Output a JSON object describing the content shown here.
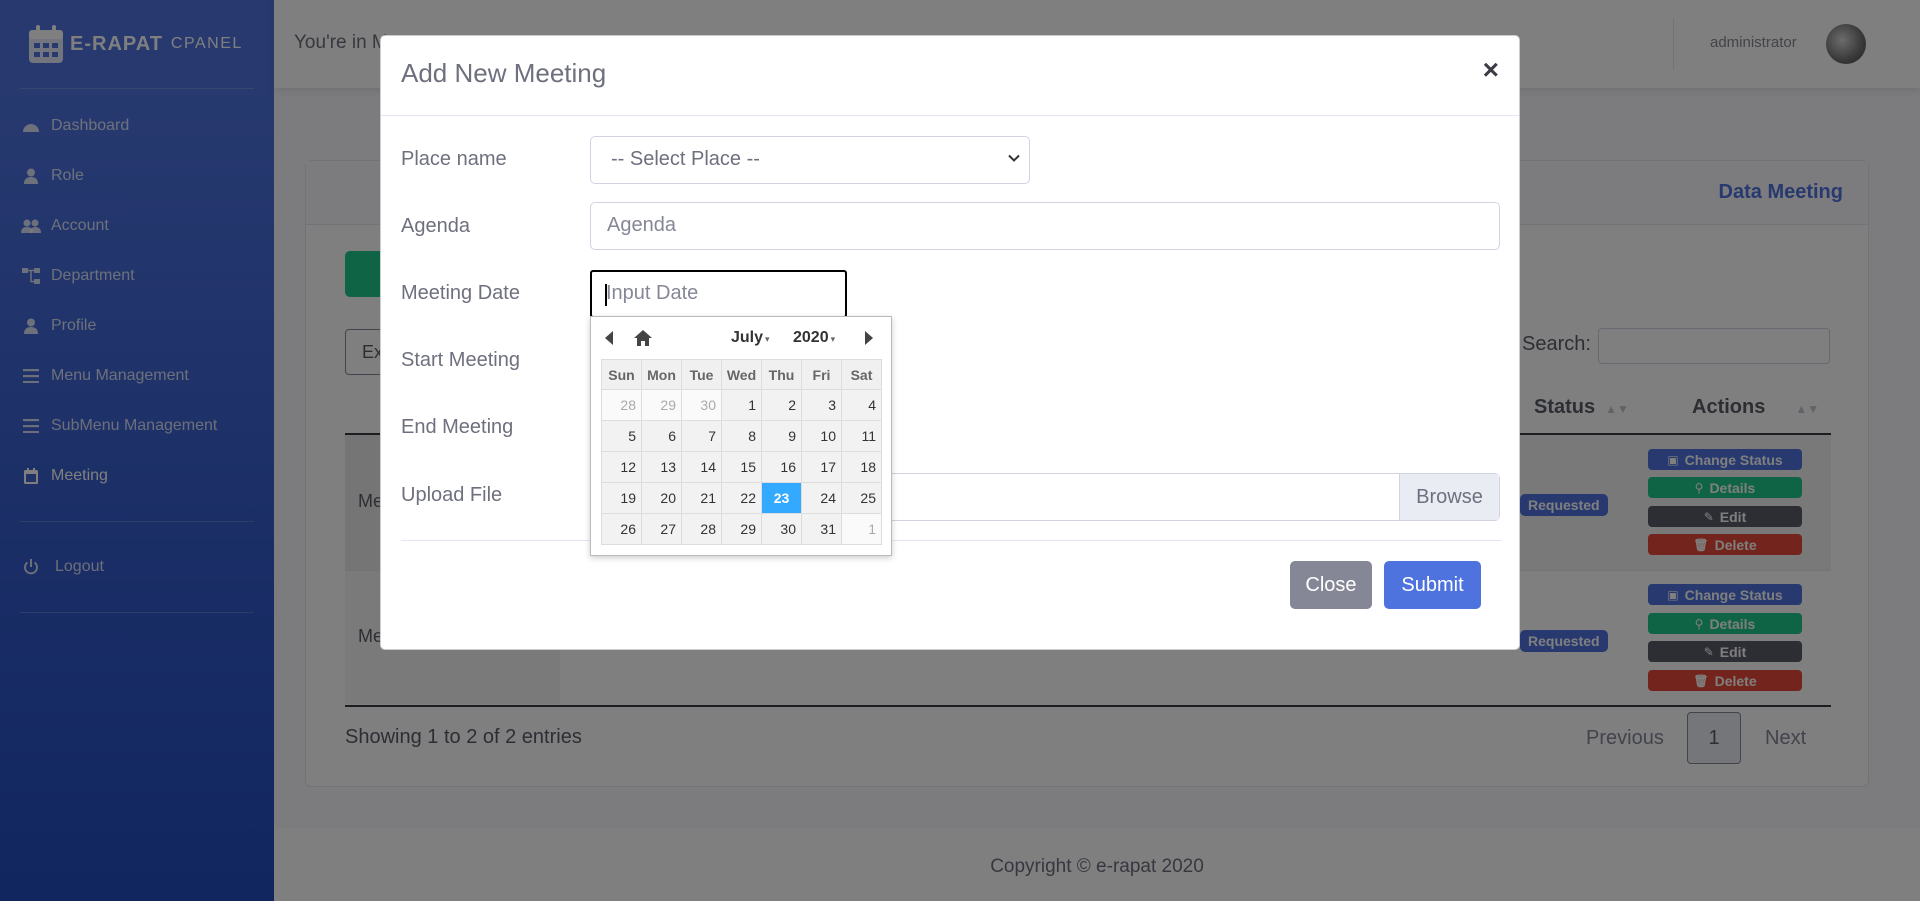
{
  "sidebar": {
    "brand_main": "E-RAPAT",
    "brand_sub": "CPANEL",
    "items": [
      {
        "label": "Dashboard",
        "icon": "dashboard-icon"
      },
      {
        "label": "Role",
        "icon": "user-icon"
      },
      {
        "label": "Account",
        "icon": "users-icon"
      },
      {
        "label": "Department",
        "icon": "sitemap-icon"
      },
      {
        "label": "Profile",
        "icon": "user-icon"
      },
      {
        "label": "Menu Management",
        "icon": "list-icon"
      },
      {
        "label": "SubMenu Management",
        "icon": "list-icon"
      },
      {
        "label": "Meeting",
        "icon": "calendar-icon"
      }
    ],
    "logout": "Logout"
  },
  "topbar": {
    "greeting": "You're in M",
    "user": "administrator"
  },
  "card": {
    "title": "Data Meeting",
    "export_label": "Ex",
    "search_label": "Search:",
    "columns": {
      "status": "Status",
      "actions": "Actions"
    },
    "rows": [
      {
        "first": "Me",
        "status": "Requested"
      },
      {
        "first": "Me",
        "status": "Requested"
      }
    ],
    "actions": {
      "change_status": "Change Status",
      "details": "Details",
      "edit": "Edit",
      "delete": "Delete"
    },
    "info": "Showing 1 to 2 of 2 entries",
    "pagination": {
      "previous": "Previous",
      "current": "1",
      "next": "Next"
    }
  },
  "footer": {
    "copyright": "Copyright © e-rapat 2020"
  },
  "modal": {
    "title": "Add New Meeting",
    "close_x": "×",
    "labels": {
      "place": "Place name",
      "agenda": "Agenda",
      "date": "Meeting Date",
      "start": "Start Meeting",
      "end": "End Meeting",
      "upload": "Upload File"
    },
    "place_selected": "-- Select Place --",
    "agenda_placeholder": "Agenda",
    "date_placeholder": "Input Date",
    "browse": "Browse",
    "close_button": "Close",
    "submit_button": "Submit"
  },
  "datepicker": {
    "month": "July",
    "year": "2020",
    "weekdays": [
      "Sun",
      "Mon",
      "Tue",
      "Wed",
      "Thu",
      "Fri",
      "Sat"
    ],
    "weeks": [
      [
        "28",
        "29",
        "30",
        "1",
        "2",
        "3",
        "4"
      ],
      [
        "5",
        "6",
        "7",
        "8",
        "9",
        "10",
        "11"
      ],
      [
        "12",
        "13",
        "14",
        "15",
        "16",
        "17",
        "18"
      ],
      [
        "19",
        "20",
        "21",
        "22",
        "23",
        "24",
        "25"
      ],
      [
        "26",
        "27",
        "28",
        "29",
        "30",
        "31",
        "1"
      ]
    ],
    "selected": "23"
  },
  "colors": {
    "primary": "#4e73df",
    "success": "#1cc88a",
    "danger": "#e74a3b",
    "dark": "#5a5c69",
    "picker_selected": "#33aaff"
  }
}
